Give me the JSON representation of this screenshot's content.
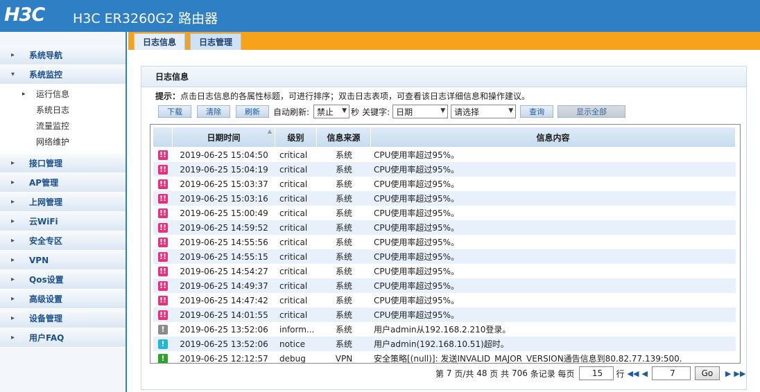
{
  "header": {
    "logo": "H3C",
    "title": "H3C ER3260G2 路由器"
  },
  "tabs": [
    {
      "label": "日志信息"
    },
    {
      "label": "日志管理"
    }
  ],
  "sidebar": {
    "groups": [
      {
        "label": "系统导航"
      },
      {
        "label": "系统监控"
      },
      {
        "label": "接口管理"
      },
      {
        "label": "AP管理"
      },
      {
        "label": "上网管理"
      },
      {
        "label": "云WiFi"
      },
      {
        "label": "安全专区"
      },
      {
        "label": "VPN"
      },
      {
        "label": "Qos设置"
      },
      {
        "label": "高级设置"
      },
      {
        "label": "设备管理"
      },
      {
        "label": "用户FAQ"
      }
    ],
    "sub_items": [
      {
        "label": "运行信息"
      },
      {
        "label": "系统日志"
      },
      {
        "label": "流量监控"
      },
      {
        "label": "网络维护"
      }
    ]
  },
  "panel": {
    "title": "日志信息",
    "hint_prefix": "提示：",
    "hint_text": "点击日志信息的各属性标题，可进行排序；双击日志表项，可查看该日志详细信息和操作建议。"
  },
  "toolbar": {
    "download": "下载",
    "clear": "清除",
    "refresh": "刷新",
    "auto_refresh_label": "自动刷新:",
    "auto_refresh_value": "禁止",
    "seconds_label": "秒",
    "keyword_label": "关键字:",
    "keyword_field": "日期",
    "keyword_value": "请选择",
    "query": "查询",
    "show_all": "显示全部"
  },
  "table": {
    "columns": [
      "日期时间",
      "级别",
      "信息来源",
      "信息内容"
    ],
    "rows": [
      {
        "time": "2019-06-25 15:04:50",
        "level": "critical",
        "source": "系统",
        "content": "CPU使用率超过95%。"
      },
      {
        "time": "2019-06-25 15:04:19",
        "level": "critical",
        "source": "系统",
        "content": "CPU使用率超过95%。"
      },
      {
        "time": "2019-06-25 15:03:37",
        "level": "critical",
        "source": "系统",
        "content": "CPU使用率超过95%。"
      },
      {
        "time": "2019-06-25 15:03:16",
        "level": "critical",
        "source": "系统",
        "content": "CPU使用率超过95%。"
      },
      {
        "time": "2019-06-25 15:00:49",
        "level": "critical",
        "source": "系统",
        "content": "CPU使用率超过95%。"
      },
      {
        "time": "2019-06-25 14:59:52",
        "level": "critical",
        "source": "系统",
        "content": "CPU使用率超过95%。"
      },
      {
        "time": "2019-06-25 14:55:56",
        "level": "critical",
        "source": "系统",
        "content": "CPU使用率超过95%。"
      },
      {
        "time": "2019-06-25 14:55:15",
        "level": "critical",
        "source": "系统",
        "content": "CPU使用率超过95%。"
      },
      {
        "time": "2019-06-25 14:54:27",
        "level": "critical",
        "source": "系统",
        "content": "CPU使用率超过95%。"
      },
      {
        "time": "2019-06-25 14:49:37",
        "level": "critical",
        "source": "系统",
        "content": "CPU使用率超过95%。"
      },
      {
        "time": "2019-06-25 14:47:42",
        "level": "critical",
        "source": "系统",
        "content": "CPU使用率超过95%。"
      },
      {
        "time": "2019-06-25 14:01:55",
        "level": "critical",
        "source": "系统",
        "content": "CPU使用率超过95%。"
      },
      {
        "time": "2019-06-25 13:52:06",
        "level": "inform...",
        "source": "系统",
        "content": "用户admin从192.168.2.210登录。"
      },
      {
        "time": "2019-06-25 13:52:06",
        "level": "notice",
        "source": "系统",
        "content": "用户admin(192.168.10.51)超时。"
      },
      {
        "time": "2019-06-25 12:12:57",
        "level": "debug",
        "source": "VPN",
        "content": "安全策略[(null)]: 发送INVALID_MAJOR_VERSION通告信息到80.82.77.139:500."
      }
    ]
  },
  "severity_colors": {
    "critical": "#e8317a",
    "inform": "#8c8c8c",
    "notice": "#1fb8d8",
    "debug": "#2aa52a"
  },
  "pager": {
    "prefix": "第",
    "page": "7",
    "mid1": "页/共",
    "total_pages": "48",
    "mid2": "页 共",
    "total_records": "706",
    "mid3": "条记录 每页",
    "per_page": "15",
    "row_label": "行",
    "goto_page": "7",
    "go": "Go"
  }
}
